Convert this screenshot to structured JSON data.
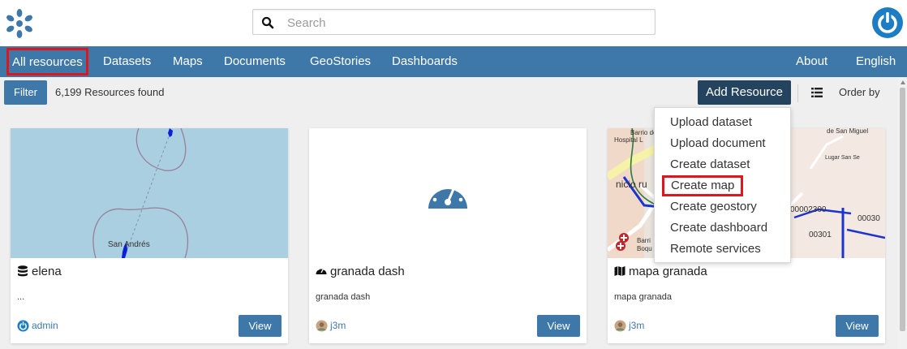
{
  "header": {
    "logo_icon": "geonode-logo-icon",
    "search": {
      "placeholder": "Search",
      "value": ""
    },
    "user_icon": "power-user-icon"
  },
  "nav": {
    "items": [
      {
        "label": "All resources",
        "active": true
      },
      {
        "label": "Datasets"
      },
      {
        "label": "Maps"
      },
      {
        "label": "Documents"
      },
      {
        "label": "GeoStories"
      },
      {
        "label": "Dashboards"
      }
    ],
    "right": [
      {
        "label": "About"
      },
      {
        "label": "English"
      }
    ]
  },
  "toolbar": {
    "filter_label": "Filter",
    "count_text": "6,199 Resources found",
    "add_resource_label": "Add Resource",
    "order_label": "Order by"
  },
  "add_resource_menu": {
    "items": [
      {
        "label": "Upload dataset"
      },
      {
        "label": "Upload document"
      },
      {
        "label": "Create dataset"
      },
      {
        "label": "Create map",
        "highlighted": true
      },
      {
        "label": "Create geostory"
      },
      {
        "label": "Create dashboard"
      },
      {
        "label": "Remote services"
      }
    ]
  },
  "cards": [
    {
      "title": "elena",
      "type_icon": "database-icon",
      "description": "...",
      "owner": "admin",
      "view_label": "View",
      "thumb_label": "San Andrés"
    },
    {
      "title": "granada dash",
      "type_icon": "dashboard-icon",
      "description": "granada dash",
      "owner": "j3m",
      "view_label": "View"
    },
    {
      "title": "mapa granada",
      "type_icon": "map-icon",
      "description": "mapa granada",
      "owner": "j3m",
      "view_label": "View",
      "thumb_texts": [
        "Barrio de",
        "Hospital L",
        "nicio ru",
        "Barri",
        "Boqu",
        "de San Miguel",
        "Lugar San Se",
        "00002300",
        "00301",
        "00030"
      ]
    }
  ],
  "colors": {
    "nav": "#3e78a9",
    "accent": "#3e78a9",
    "add_button": "#24435f",
    "highlight": "#e0161c",
    "sea": "#a9cfe0"
  }
}
